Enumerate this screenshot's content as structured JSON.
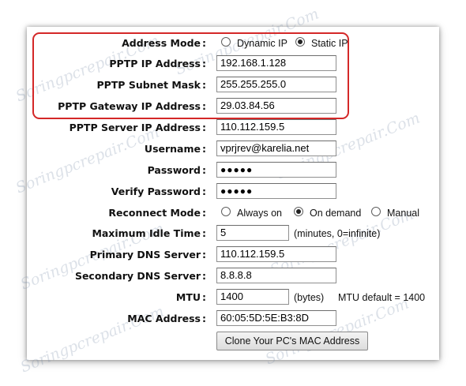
{
  "watermark": "Soringpcrepair.Com",
  "form": {
    "address_mode": {
      "label": "Address Mode",
      "options": [
        "Dynamic IP",
        "Static IP"
      ],
      "selected": "Static IP"
    },
    "pptp_ip": {
      "label": "PPTP IP Address",
      "value": "192.168.1.128"
    },
    "pptp_subnet": {
      "label": "PPTP Subnet Mask",
      "value": "255.255.255.0"
    },
    "pptp_gateway": {
      "label": "PPTP Gateway IP Address",
      "value": "29.03.84.56"
    },
    "pptp_server": {
      "label": "PPTP Server IP Address",
      "value": "110.112.159.5"
    },
    "username": {
      "label": "Username",
      "value": "vprjrev@karelia.net"
    },
    "password": {
      "label": "Password",
      "value": "●●●●●"
    },
    "verify_password": {
      "label": "Verify Password",
      "value": "●●●●●"
    },
    "reconnect_mode": {
      "label": "Reconnect Mode",
      "options": [
        "Always on",
        "On demand",
        "Manual"
      ],
      "selected": "On demand"
    },
    "max_idle": {
      "label": "Maximum Idle Time",
      "value": "5",
      "note": "(minutes, 0=infinite)"
    },
    "primary_dns": {
      "label": "Primary DNS Server",
      "value": "110.112.159.5"
    },
    "secondary_dns": {
      "label": "Secondary DNS Server",
      "value": "8.8.8.8"
    },
    "mtu": {
      "label": "MTU",
      "value": "1400",
      "unit": "(bytes)",
      "note": "MTU default = 1400"
    },
    "mac": {
      "label": "MAC Address",
      "value": "60:05:5D:5E:B3:8D"
    },
    "clone_button": "Clone Your PC's MAC Address"
  },
  "colors": {
    "highlight": "#d42828"
  }
}
